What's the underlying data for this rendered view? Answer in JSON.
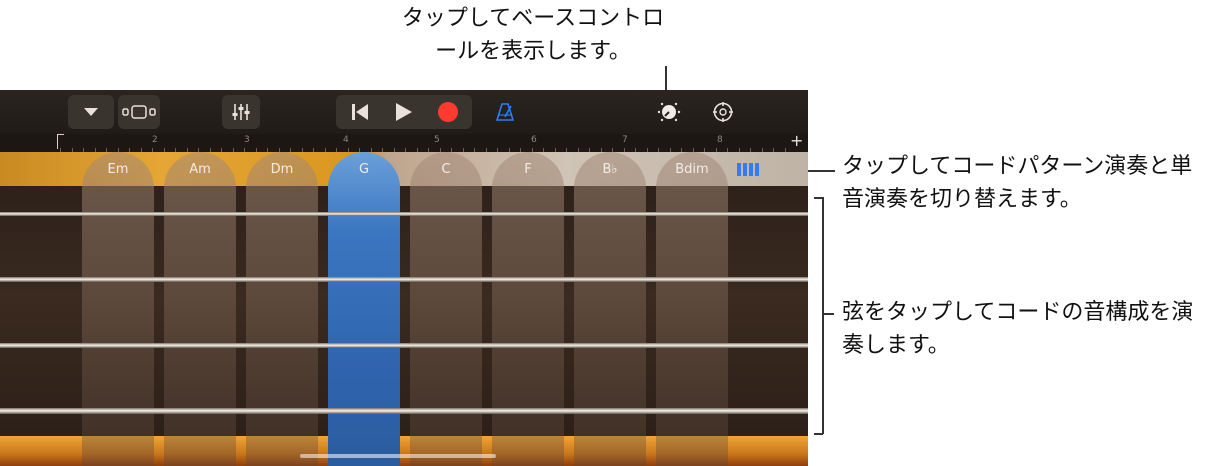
{
  "callouts": {
    "bass_controls": "タップしてベースコントロールを表示します。",
    "chord_toggle": "タップしてコードパターン演奏と単音演奏を切り替えます。",
    "strings": "弦をタップしてコードの音構成を演奏します。"
  },
  "toolbar": {
    "icons": [
      "chevron-down-icon",
      "browser-icon",
      "mixer-icon",
      "rewind-icon",
      "play-icon",
      "record-icon",
      "metronome-icon",
      "bass-controls-knob-icon",
      "settings-icon"
    ],
    "accent_color": "#2e7cf6",
    "record_color": "#ff3b30"
  },
  "ruler": {
    "bar_numbers": [
      "2",
      "3",
      "4",
      "5",
      "6",
      "7",
      "8"
    ],
    "add_label": "+"
  },
  "chords": [
    {
      "label": "Em"
    },
    {
      "label": "Am"
    },
    {
      "label": "Dm"
    },
    {
      "label": "G"
    },
    {
      "label": "C"
    },
    {
      "label": "F"
    },
    {
      "label": "B♭"
    },
    {
      "label": "Bdim"
    }
  ],
  "selected_chord": "G"
}
